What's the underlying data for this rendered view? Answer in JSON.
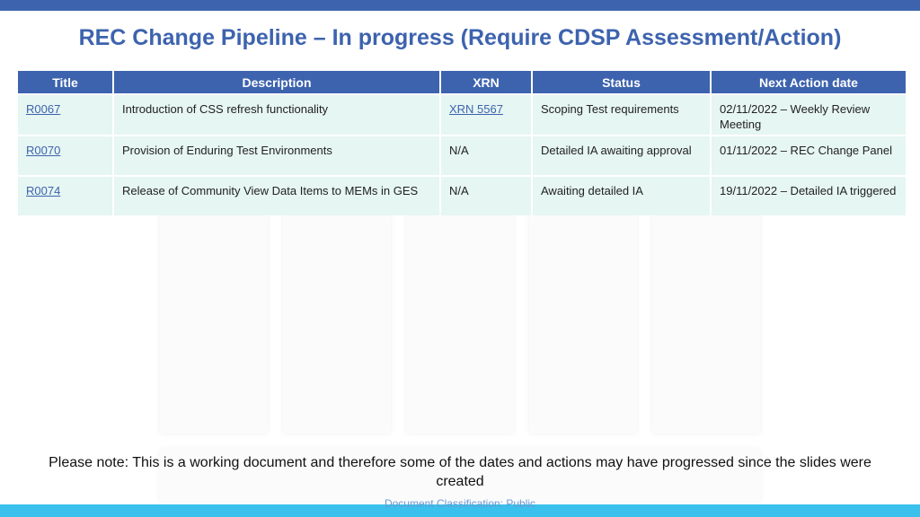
{
  "title": "REC Change Pipeline – In progress (Require CDSP Assessment/Action)",
  "table": {
    "headers": [
      "Title",
      "Description",
      "XRN",
      "Status",
      "Next Action date"
    ],
    "rows": [
      {
        "title": "R0067",
        "description": "Introduction of CSS refresh functionality",
        "xrn": "XRN 5567",
        "status": "Scoping Test requirements",
        "next_action": "02/11/2022 – Weekly Review Meeting"
      },
      {
        "title": "R0070",
        "description": "Provision of Enduring Test Environments",
        "xrn": "N/A",
        "status": "Detailed IA awaiting approval",
        "next_action": "01/11/2022 – REC Change Panel"
      },
      {
        "title": "R0074",
        "description": "Release of Community View Data Items to MEMs in GES",
        "xrn": "N/A",
        "status": "Awaiting detailed IA",
        "next_action": "19/11/2022 – Detailed IA triggered"
      }
    ]
  },
  "note": "Please note: This is a working document and therefore some of the dates and actions may have progressed since the slides were created",
  "footer": "Document Classification: Public",
  "colors": {
    "header_blue": "#3d63ae",
    "row_fill": "#e6f6f2",
    "bottom_bar": "#3ac0ec"
  }
}
